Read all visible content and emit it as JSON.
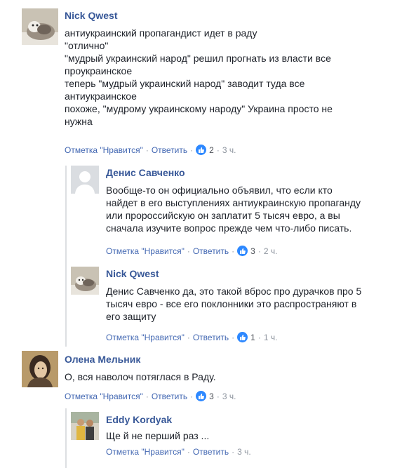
{
  "like_label": "Отметка \"Нравится\"",
  "reply_label": "Ответить",
  "dot": "·",
  "comments": [
    {
      "author": "Nick Qwest",
      "lines": [
        "антиукраинский пропагандист идет в раду",
        "\"отлично\"",
        "\"мудрый украинский народ\" решил прогнать из власти все",
        "проукраинское",
        "теперь \"мудрый украинский народ\" заводит туда все",
        "антиукраинское",
        "похоже, \"мудрому украинскому народу\" Украина просто не",
        "нужна"
      ],
      "reactions": "2",
      "time": "3 ч."
    },
    {
      "author": "Денис Савченко",
      "lines": [
        "Вообще-то он официально объявил, что если кто",
        "найдет в его выступлениях антиукраинскую пропаганду",
        "или пророссийскую он заплатит 5 тысяч евро, а вы",
        "сначала изучите вопрос прежде чем что-либо писать."
      ],
      "reactions": "3",
      "time": "2 ч."
    },
    {
      "author": "Nick Qwest",
      "lines": [
        "Денис Савченко да, это такой вброс про дурачков про 5",
        "тысяч евро - все его поклонники это распространяют в",
        "его защиту"
      ],
      "reactions": "1",
      "time": "1 ч."
    },
    {
      "author": "Олена Мельник",
      "lines": [
        "О, вся наволоч потяглася в Раду."
      ],
      "reactions": "3",
      "time": "3 ч."
    },
    {
      "author": "Eddy Kordyak",
      "lines": [
        "Ще й не перший раз ..."
      ],
      "reactions": "",
      "time": "3 ч."
    }
  ]
}
